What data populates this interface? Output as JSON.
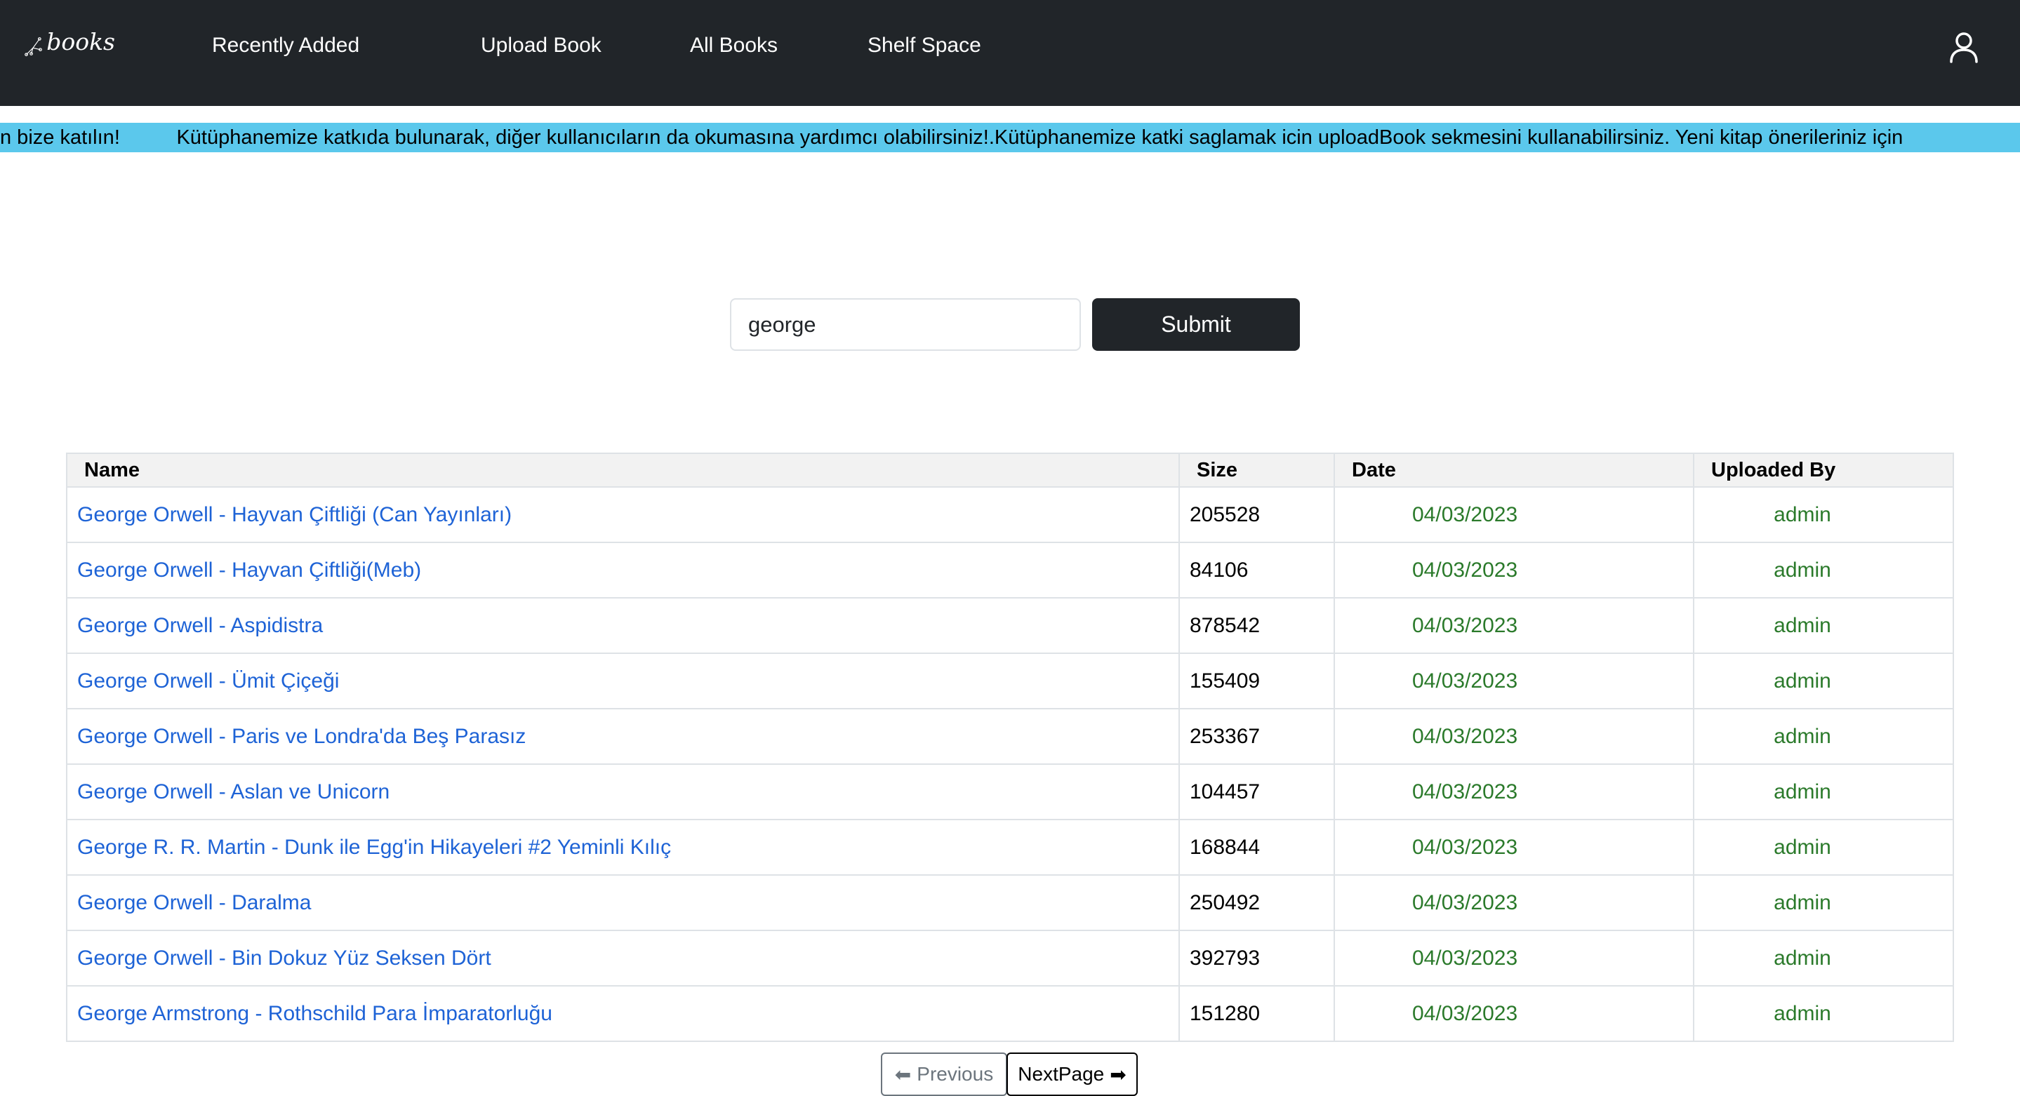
{
  "nav": {
    "brand": "books",
    "links": [
      "Recently Added",
      "Upload Book",
      "All Books",
      "Shelf Space"
    ],
    "user_icon": "user-icon"
  },
  "marquee": {
    "text": "n bize katılın!          Kütüphanemize katkıda bulunarak, diğer kullanıcıların da okumasına yardımcı olabilirsiniz!.Kütüphanemize katki saglamak icin uploadBook sekmesini kullanabilirsiniz. Yeni kitap önerileriniz için"
  },
  "search": {
    "value": "george",
    "submit_label": "Submit"
  },
  "table": {
    "headers": [
      "Name",
      "Size",
      "Date",
      "Uploaded By"
    ],
    "rows": [
      {
        "name": "George Orwell - Hayvan Çiftliği (Can Yayınları)",
        "size": "205528",
        "date": "04/03/2023",
        "uploaded_by": "admin"
      },
      {
        "name": "George Orwell - Hayvan Çiftliği(Meb)",
        "size": "84106",
        "date": "04/03/2023",
        "uploaded_by": "admin"
      },
      {
        "name": "George Orwell - Aspidistra",
        "size": "878542",
        "date": "04/03/2023",
        "uploaded_by": "admin"
      },
      {
        "name": "George Orwell - Ümit Çiçeği",
        "size": "155409",
        "date": "04/03/2023",
        "uploaded_by": "admin"
      },
      {
        "name": "George Orwell - Paris ve Londra'da Beş Parasız",
        "size": "253367",
        "date": "04/03/2023",
        "uploaded_by": "admin"
      },
      {
        "name": "George Orwell - Aslan ve Unicorn",
        "size": "104457",
        "date": "04/03/2023",
        "uploaded_by": "admin"
      },
      {
        "name": "George R. R. Martin - Dunk ile Egg'in Hikayeleri #2 Yeminli Kılıç",
        "size": "168844",
        "date": "04/03/2023",
        "uploaded_by": "admin"
      },
      {
        "name": "George Orwell - Daralma",
        "size": "250492",
        "date": "04/03/2023",
        "uploaded_by": "admin"
      },
      {
        "name": "George Orwell - Bin Dokuz Yüz Seksen Dört",
        "size": "392793",
        "date": "04/03/2023",
        "uploaded_by": "admin"
      },
      {
        "name": "George Armstrong - Rothschild Para İmparatorluğu",
        "size": "151280",
        "date": "04/03/2023",
        "uploaded_by": "admin"
      }
    ]
  },
  "pagination": {
    "prev_icon": "⬅",
    "prev_label": "Previous",
    "next_label": "NextPage",
    "next_icon": "➡"
  },
  "colors": {
    "navbar": "#212529",
    "marquee": "#5bc8ec",
    "link": "#1e63d6",
    "meta_green": "#2b7a2b"
  }
}
